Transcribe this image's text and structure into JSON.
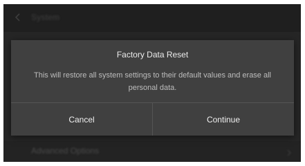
{
  "background": {
    "header_title": "System",
    "row_label": "Advanced Options"
  },
  "dialog": {
    "title": "Factory Data Reset",
    "message": "This will restore all system settings to their default values and erase all personal data.",
    "cancel_label": "Cancel",
    "continue_label": "Continue"
  },
  "colors": {
    "background": "#262626",
    "dialog_surface": "#404040",
    "divider": "#555555",
    "title_text": "#ececec",
    "message_text": "#bdbdbd",
    "button_text": "#f0f0f0"
  },
  "icons": {
    "back": "chevron-left-icon",
    "row": "chevron-right-icon"
  }
}
